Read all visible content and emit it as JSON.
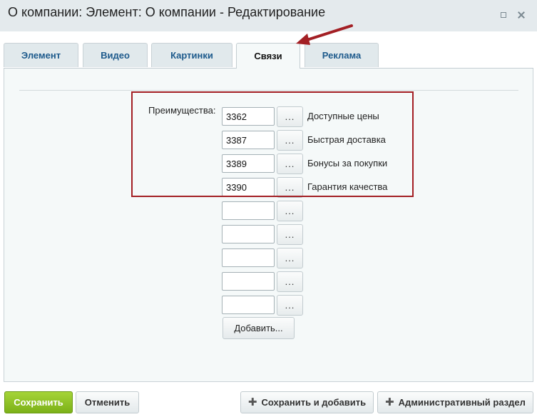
{
  "window": {
    "title": "О компании: Элемент: О компании - Редактирование"
  },
  "tabs": [
    {
      "label": "Элемент",
      "active": false
    },
    {
      "label": "Видео",
      "active": false
    },
    {
      "label": "Картинки",
      "active": false
    },
    {
      "label": "Связи",
      "active": true
    },
    {
      "label": "Реклама",
      "active": false
    }
  ],
  "form": {
    "field_label": "Преимущества:",
    "browse_label": "...",
    "rows": [
      {
        "value": "3362",
        "name": "Доступные цены"
      },
      {
        "value": "3387",
        "name": "Быстрая доставка"
      },
      {
        "value": "3389",
        "name": "Бонусы за покупки"
      },
      {
        "value": "3390",
        "name": "Гарантия качества"
      },
      {
        "value": "",
        "name": ""
      },
      {
        "value": "",
        "name": ""
      },
      {
        "value": "",
        "name": ""
      },
      {
        "value": "",
        "name": ""
      },
      {
        "value": "",
        "name": ""
      }
    ],
    "add_label": "Добавить..."
  },
  "footer": {
    "save_label": "Сохранить",
    "cancel_label": "Отменить",
    "save_add_label": "Сохранить и добавить",
    "admin_label": "Административный раздел"
  },
  "colors": {
    "annotation_red": "#a31f24",
    "save_green": "#8bbf1f",
    "tab_text_blue": "#1d5a8c"
  }
}
